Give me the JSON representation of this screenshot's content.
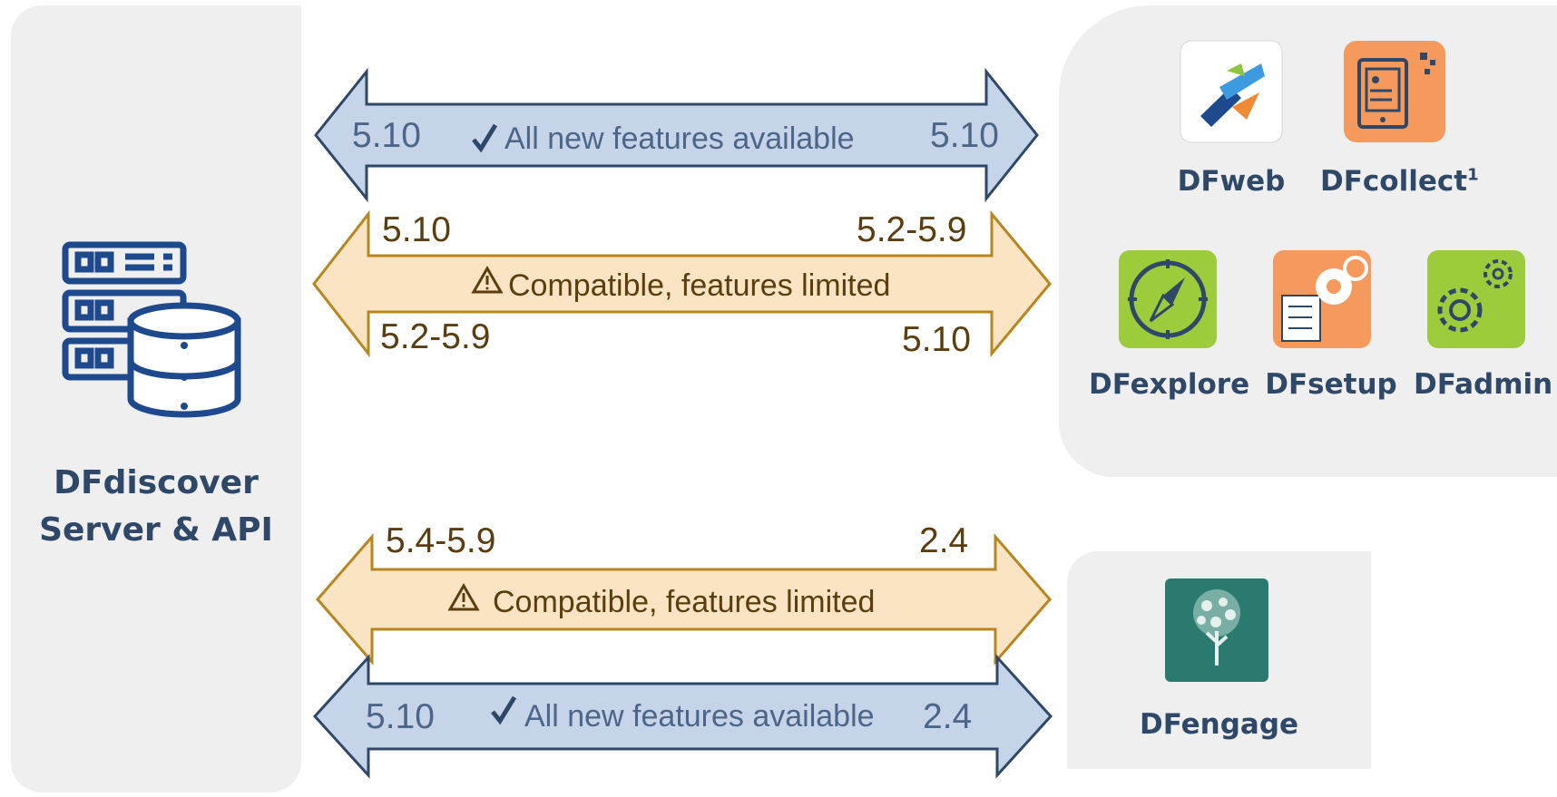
{
  "server": {
    "title_line1": "DFdiscover",
    "title_line2": "Server & API"
  },
  "apps": {
    "dfweb": "DFweb",
    "dfcollect": "DFcollect",
    "dfcollect_sup": "1",
    "dfexplore": "DFexplore",
    "dfsetup": "DFsetup",
    "dfadmin": "DFadmin",
    "dfengage": "DFengage"
  },
  "arrows": {
    "a1": {
      "left": "5.10",
      "middle": "All new features available",
      "right": "5.10",
      "icon": "check-icon"
    },
    "a2": {
      "top_left": "5.10",
      "top_right": "5.2-5.9",
      "middle": "Compatible, features limited",
      "bottom_left": "5.2-5.9",
      "bottom_right": "5.10",
      "icon": "warning-icon"
    },
    "a3": {
      "top_left": "5.4-5.9",
      "top_right": "2.4",
      "middle": "Compatible, features limited",
      "icon": "warning-icon"
    },
    "a4": {
      "left": "5.10",
      "middle": "All new features available",
      "right": "2.4",
      "icon": "check-icon"
    }
  },
  "colors": {
    "blue_fill": "#c5d4e9",
    "blue_stroke": "#2f4867",
    "gold_fill": "#fbe4c4",
    "gold_stroke": "#b8861f",
    "title": "#2f4867"
  }
}
